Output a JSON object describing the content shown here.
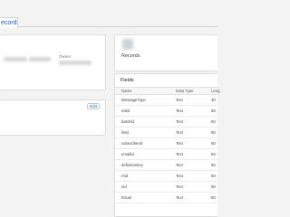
{
  "tabs": [
    {
      "label": "ecords"
    }
  ],
  "details": {
    "owner_label": "Owner"
  },
  "description_panel": {
    "edit_label": "Edit"
  },
  "record_summary": {
    "title": "Records"
  },
  "fields_table": {
    "title": "Fields",
    "columns": [
      "Name",
      "Data Type",
      "Leng"
    ],
    "rows": [
      {
        "name": "MessageType",
        "type": "Text",
        "length": "40"
      },
      {
        "name": "solid",
        "type": "Text",
        "length": "50"
      },
      {
        "name": "batchid",
        "type": "Text",
        "length": "50"
      },
      {
        "name": "field",
        "type": "Text",
        "length": "50"
      },
      {
        "name": "subscriberid",
        "type": "Text",
        "length": "50"
      },
      {
        "name": "emailid",
        "type": "Text",
        "length": "50"
      },
      {
        "name": "definitionkey",
        "type": "Text",
        "length": "50"
      },
      {
        "name": "mid",
        "type": "Text",
        "length": "50"
      },
      {
        "name": "eid",
        "type": "Text",
        "length": "50"
      },
      {
        "name": "Email",
        "type": "Text",
        "length": "50"
      }
    ]
  }
}
